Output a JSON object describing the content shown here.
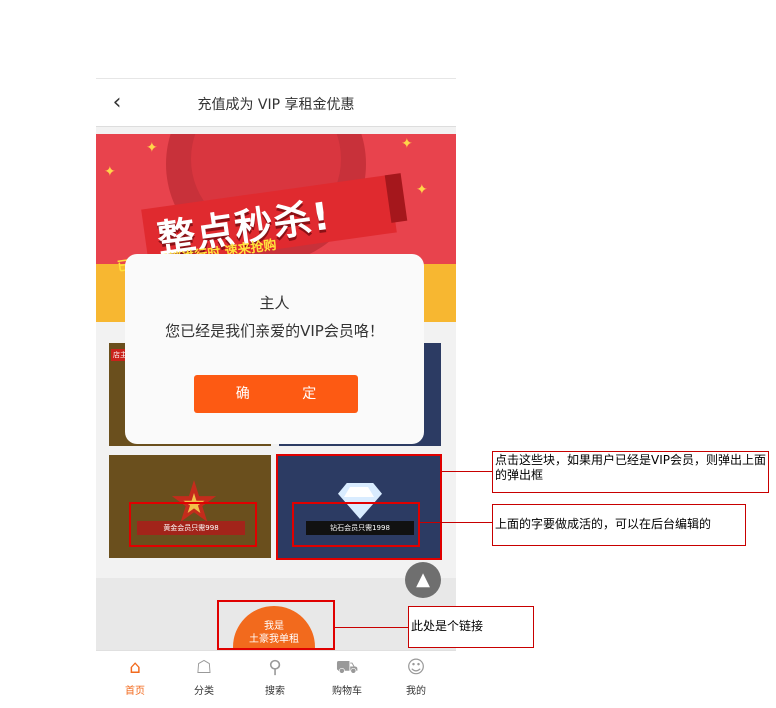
{
  "nav": {
    "back_icon": "‹",
    "title": "充值成为 VIP 享租金优惠"
  },
  "banner": {
    "headline": "整点秒杀!",
    "subline": "已低价促销进行时 速来抢购"
  },
  "tiles": {
    "gold_top_tag": "店主",
    "gold_ribbon": "黄金会员只需998",
    "diamond_ribbon": "钻石会员只需1998"
  },
  "vip_link": {
    "line1": "我是",
    "line2": "土豪我单租"
  },
  "fab_icon": "▲",
  "dialog": {
    "title": "主人",
    "message": "您已经是我们亲爱的VIP会员咯！",
    "confirm_label": "确 定"
  },
  "tabbar": [
    {
      "label": "首页",
      "icon": "home-icon",
      "active": true
    },
    {
      "label": "分类",
      "icon": "category-icon",
      "active": false
    },
    {
      "label": "搜索",
      "icon": "search-icon",
      "active": false
    },
    {
      "label": "购物车",
      "icon": "cart-icon",
      "active": false
    },
    {
      "label": "我的",
      "icon": "user-icon",
      "active": false
    }
  ],
  "annotations": {
    "tiles_click": "点击这些块，如果用户已经是VIP会员，则弹出上面的弹出框",
    "text_editable": "上面的字要做成活的，可以在后台编辑的",
    "link_note": "此处是个链接"
  },
  "colors": {
    "accent": "#fd5a13",
    "tab_active": "#f26a1d",
    "highlight": "#e00000"
  }
}
